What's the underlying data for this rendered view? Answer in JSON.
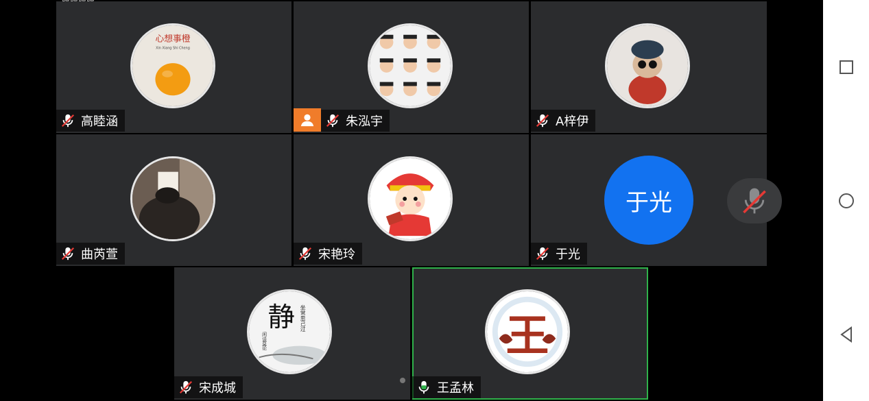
{
  "top_text": "脱脱脱脱",
  "participants": [
    {
      "name": "高睦涵",
      "avatar": "orange-avatar-icon",
      "muted": true
    },
    {
      "name": "朱泓宇",
      "avatar": "boy-grid-avatar-icon",
      "muted": true,
      "host": true
    },
    {
      "name": "A梓伊",
      "avatar": "cat-avatar-icon",
      "muted": true
    },
    {
      "name": "曲芮萱",
      "avatar": "reading-girl-avatar-icon",
      "muted": true
    },
    {
      "name": "宋艳玲",
      "avatar": "fortune-child-avatar-icon",
      "muted": true
    },
    {
      "name": "于光",
      "avatar_text": "于光",
      "muted": true
    },
    {
      "name": "宋成城",
      "avatar": "calligraphy-avatar-icon",
      "muted": true
    },
    {
      "name": "王孟林",
      "avatar": "wang-emblem-avatar-icon",
      "muted": false,
      "speaking": true
    }
  ],
  "avatar_texts": {
    "orange_title": "心想事橙",
    "orange_sub": "Xin Xiang Shi Cheng",
    "calligraphy_main": "静",
    "calligraphy_side1": "坐常思己过",
    "calligraphy_side2": "闲谈莫论",
    "wang_char": "王"
  },
  "colors": {
    "tile_bg": "#2b2c2e",
    "active_border": "#2fb24a",
    "host_badge": "#f07c2a",
    "text_avatar": "#1272f0",
    "muted_red": "#e53935"
  },
  "nav": [
    "recent-apps-icon",
    "home-icon",
    "back-icon"
  ]
}
